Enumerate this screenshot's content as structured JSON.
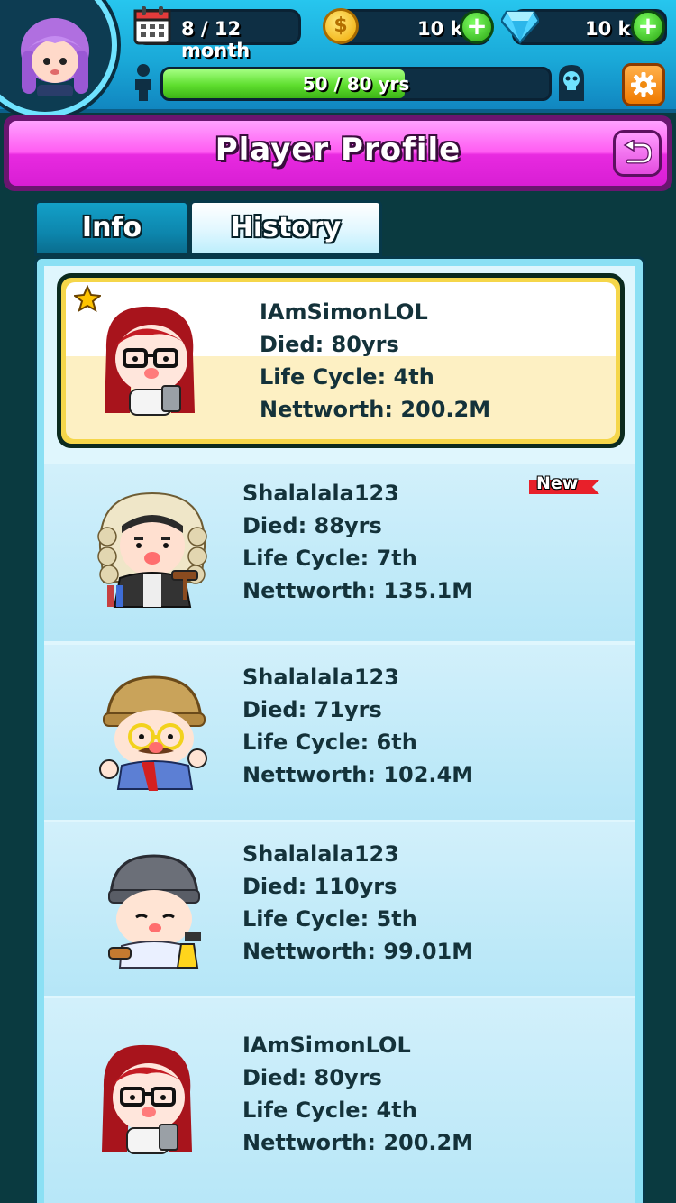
{
  "header": {
    "month_label": "8 / 12 month",
    "coins": "10 k",
    "gems": "10 k",
    "age_progress_label": "50 / 80 yrs",
    "age_progress_fraction": 0.625
  },
  "banner": {
    "title": "Player Profile"
  },
  "tabs": [
    {
      "label": "Info",
      "active": false
    },
    {
      "label": "History",
      "active": true
    }
  ],
  "history": [
    {
      "name": "IAmSimonLOL",
      "died": "Died: 80yrs",
      "cycle": "Life Cycle: 4th",
      "networth": "Nettworth: 200.2M",
      "featured": true,
      "character": "redhead-woman-glasses"
    },
    {
      "name": "Shalalala123",
      "died": "Died: 88yrs",
      "cycle": "Life Cycle: 7th",
      "networth": "Nettworth: 135.1M",
      "badge": "New",
      "character": "judge-with-wig"
    },
    {
      "name": "Shalalala123",
      "died": "Died: 71yrs",
      "cycle": "Life Cycle: 6th",
      "networth": "Nettworth: 102.4M",
      "character": "old-man-cap-scarf"
    },
    {
      "name": "Shalalala123",
      "died": "Died: 110yrs",
      "cycle": "Life Cycle: 5th",
      "networth": "Nettworth: 99.01M",
      "character": "beanie-worker"
    },
    {
      "name": "IAmSimonLOL",
      "died": "Died: 80yrs",
      "cycle": "Life Cycle: 4th",
      "networth": "Nettworth: 200.2M",
      "character": "redhead-woman-glasses"
    }
  ],
  "colors": {
    "top_bar": "#1aa9d8",
    "banner_pink": "#ff5cf2",
    "plus_green": "#2aa412",
    "featured_gold": "#f5d64a",
    "text_dark": "#14323a"
  }
}
